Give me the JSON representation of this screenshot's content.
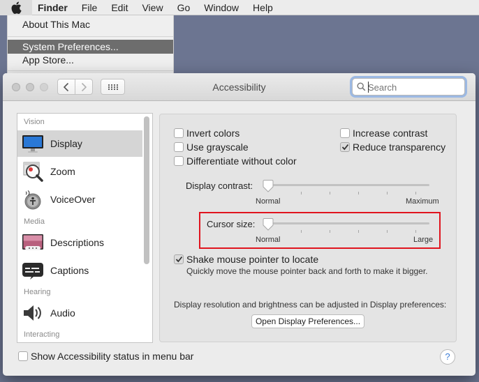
{
  "menubar": {
    "app": "Finder",
    "items": [
      "File",
      "Edit",
      "View",
      "Go",
      "Window",
      "Help"
    ]
  },
  "apple_menu": {
    "items": [
      "About This Mac",
      "System Preferences...",
      "App Store..."
    ],
    "highlighted": "System Preferences..."
  },
  "window": {
    "title": "Accessibility",
    "search_placeholder": "Search"
  },
  "sidebar": {
    "sections": {
      "vision": "Vision",
      "media": "Media",
      "hearing": "Hearing",
      "interacting": "Interacting"
    },
    "items": [
      "Display",
      "Zoom",
      "VoiceOver",
      "Descriptions",
      "Captions",
      "Audio"
    ],
    "selected": "Display"
  },
  "display": {
    "invert_colors": "Invert colors",
    "use_grayscale": "Use grayscale",
    "differentiate_without_color": "Differentiate without color",
    "increase_contrast": "Increase contrast",
    "reduce_transparency": "Reduce transparency",
    "reduce_transparency_checked": true,
    "display_contrast_label": "Display contrast:",
    "display_contrast_min": "Normal",
    "display_contrast_max": "Maximum",
    "display_contrast_value": 0,
    "cursor_size_label": "Cursor size:",
    "cursor_size_min": "Normal",
    "cursor_size_max": "Large",
    "cursor_size_value": 0,
    "shake_label": "Shake mouse pointer to locate",
    "shake_checked": true,
    "shake_description": "Quickly move the mouse pointer back and forth to make it bigger.",
    "resolution_note": "Display resolution and brightness can be adjusted in Display preferences:",
    "open_display_prefs": "Open Display Preferences..."
  },
  "bottom": {
    "show_status": "Show Accessibility status in menu bar",
    "help": "?"
  },
  "colors": {
    "highlight_box": "#e0141e",
    "desktop": "#6c7591",
    "search_focus": "#9cb9e3"
  }
}
